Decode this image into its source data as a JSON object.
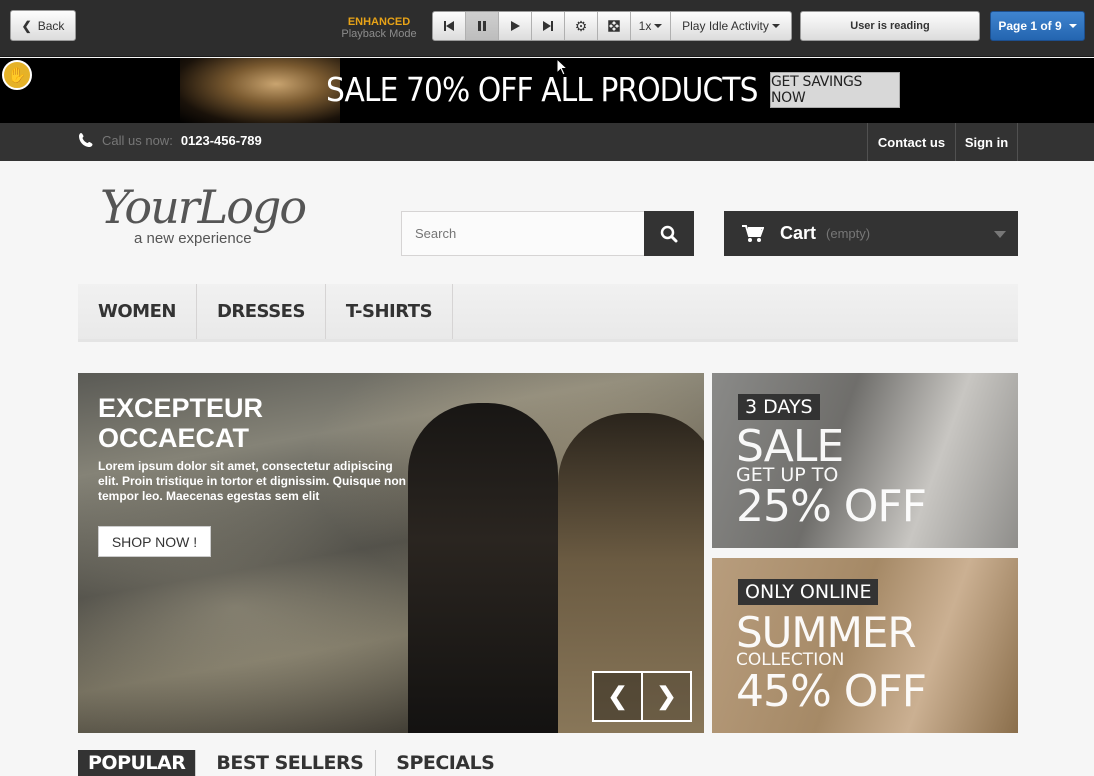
{
  "toolbar": {
    "back_label": "Back",
    "mode_title": "ENHANCED",
    "mode_subtitle": "Playback Mode",
    "speed": "1x",
    "idle_label": "Play Idle Activity",
    "status": "User is reading",
    "page": "Page 1 of 9"
  },
  "banner": {
    "text": "SALE 70% OFF ALL PRODUCTS",
    "button": "GET SAVINGS NOW"
  },
  "nav": {
    "call_label": "Call us now:",
    "phone": "0123-456-789",
    "contact": "Contact us",
    "signin": "Sign in"
  },
  "header": {
    "logo_main": "YourLogo",
    "logo_tag": "a new experience",
    "search_placeholder": "Search",
    "cart_label": "Cart",
    "cart_status": "(empty)"
  },
  "menu": [
    "WOMEN",
    "DRESSES",
    "T-SHIRTS"
  ],
  "hero": {
    "title_line1": "EXCEPTEUR",
    "title_line2": "OCCAECAT",
    "text": "Lorem ipsum dolor sit amet, consectetur adipiscing elit. Proin tristique in tortor et dignissim. Quisque non tempor leo. Maecenas egestas sem elit",
    "button": "SHOP NOW !"
  },
  "promo1": {
    "tag": "3 DAYS",
    "line1": "SALE",
    "line2": "GET UP TO",
    "line3": "25% OFF"
  },
  "promo2": {
    "tag": "ONLY ONLINE",
    "line1": "SUMMER",
    "line2": "COLLECTION",
    "line3": "45% OFF"
  },
  "tabs": [
    "POPULAR",
    "BEST SELLERS",
    "SPECIALS"
  ],
  "colors": {
    "accent_yellow": "#e5b228",
    "page_button_blue": "#2f76c2",
    "dark": "#333333"
  }
}
